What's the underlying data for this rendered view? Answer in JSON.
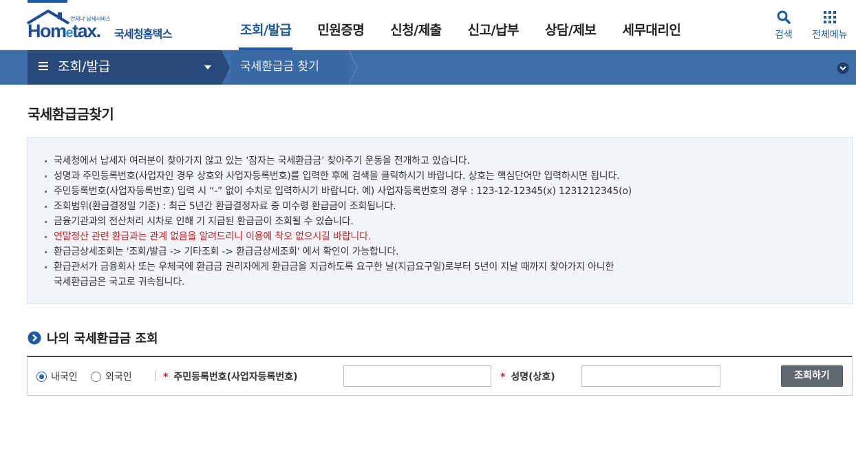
{
  "header": {
    "logo_tagline": "언제냐 납세서비스",
    "logo_brand_a": "Hom",
    "logo_brand_e": "e",
    "logo_brand_b": "tax.",
    "logo_agency": "국세청홈택스",
    "menus": [
      {
        "label": "조회/발급",
        "active": true
      },
      {
        "label": "민원증명",
        "active": false
      },
      {
        "label": "신청/제출",
        "active": false
      },
      {
        "label": "신고/납부",
        "active": false
      },
      {
        "label": "상담/제보",
        "active": false
      },
      {
        "label": "세무대리인",
        "active": false
      }
    ],
    "search_label": "검색",
    "allmenu_label": "전체메뉴"
  },
  "breadcrumb": {
    "section": "조회/발급",
    "current": "국세환급금 찾기"
  },
  "page": {
    "title": "국세환급금찾기"
  },
  "notice": {
    "items": [
      {
        "text": "국세청에서 납세자 여러분이 찾아가지 않고 있는 ‘잠자는 국세환급금’ 찾아주기 운동을 전개하고 있습니다.",
        "highlight": false
      },
      {
        "text": "성명과 주민등록번호(사업자인 경우 상호와 사업자등록번호)를 입력한 후에 검색을 클릭하시기 바랍니다. 상호는 핵심단어만 입력하시면 됩니다.",
        "highlight": false
      },
      {
        "text": "주민등록번호(사업자등록번호) 입력 시 “-” 없이 수치로 입력하시기 바랍니다. 예) 사업자등록번호의 경우 : 123-12-12345(x) 1231212345(o)",
        "highlight": false
      },
      {
        "text": "조회범위(환급결정일 기준) : 최근 5년간 환급결정자료 중 미수령 환급금이 조회됩니다.",
        "highlight": false
      },
      {
        "text": "금융기관과의 전산처리 시차로 인해 기 지급된 환급금이 조회될 수 있습니다.",
        "highlight": false
      },
      {
        "text": "연말정산 관련 환급과는 관계 없음을 알려드리니 이용에 착오 없으시길 바랍니다.",
        "highlight": true
      },
      {
        "text": "환급금상세조회는 '조회/발급 -> 기타조회 -> 환급금상세조회' 에서 확인이 가능합니다.",
        "highlight": false
      },
      {
        "text": "환급관서가 금융회사 또는 우체국에 환급금 권리자에게 환급금을 지급하도록 요구한 날(지급요구일)로부터 5년이 지날 때까지 찾아가지 아니한",
        "highlight": false,
        "cont": "국세환급금은 국고로 귀속됩니다."
      }
    ]
  },
  "lookup": {
    "title": "나의 국세환급금 조회",
    "radio_domestic": "내국인",
    "radio_foreign": "외국인",
    "selected": "domestic",
    "required_mark": "*",
    "id_label": "주민등록번호(사업자등록번호)",
    "id_value": "",
    "name_label": "성명(상호)",
    "name_value": "",
    "submit_label": "조회하기"
  },
  "colors": {
    "brand_blue": "#1d5aa6",
    "bar_dark": "#28497b",
    "bar_light": "#3e6ea7",
    "alert_red": "#d22121",
    "notice_bg": "#f1f4f9",
    "button_gray": "#5f6770"
  }
}
